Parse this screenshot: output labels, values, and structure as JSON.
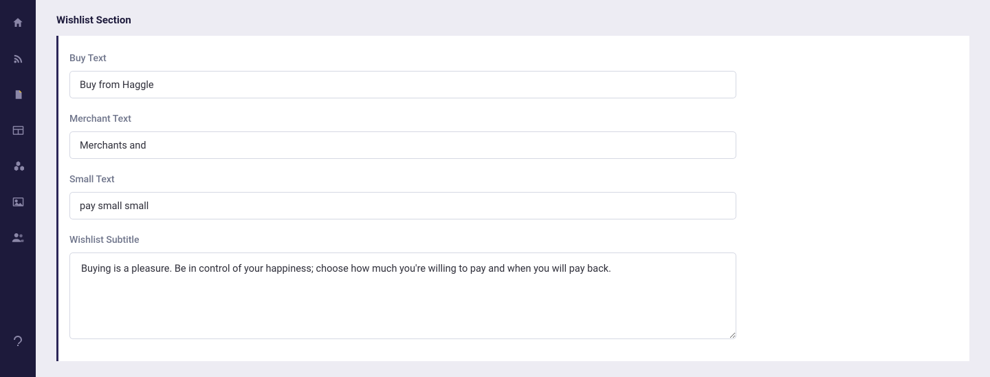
{
  "header": {
    "title": "Wishlist Section"
  },
  "form": {
    "buy_text": {
      "label": "Buy Text",
      "value": "Buy from Haggle"
    },
    "merchant_text": {
      "label": "Merchant Text",
      "value": "Merchants and"
    },
    "small_text": {
      "label": "Small Text",
      "value": "pay small small"
    },
    "wishlist_subtitle": {
      "label": "Wishlist Subtitle",
      "value": "Buying is a pleasure. Be in control of your happiness; choose how much you're willing to pay and when you will pay back."
    }
  }
}
